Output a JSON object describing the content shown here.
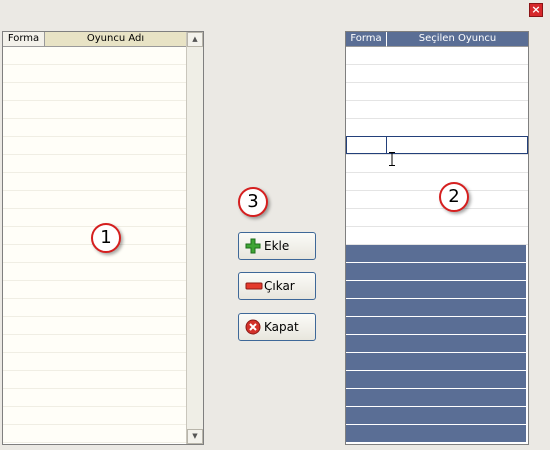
{
  "window": {
    "close_label": "×"
  },
  "left_grid": {
    "columns": [
      "Forma",
      "Oyuncu Adı"
    ],
    "row_count": 22,
    "badge": "1"
  },
  "right_grid": {
    "columns": [
      "Forma",
      "Seçilen Oyuncu"
    ],
    "white_rows": 11,
    "selected_rows": 11,
    "badge": "2"
  },
  "buttons": {
    "badge": "3",
    "add_label": "Ekle",
    "remove_label": "Çıkar",
    "close_label": "Kapat"
  },
  "colors": {
    "accent_header": "#e8e3c5",
    "selected_row": "#5a6e95",
    "badge_border": "#d51f1f"
  }
}
